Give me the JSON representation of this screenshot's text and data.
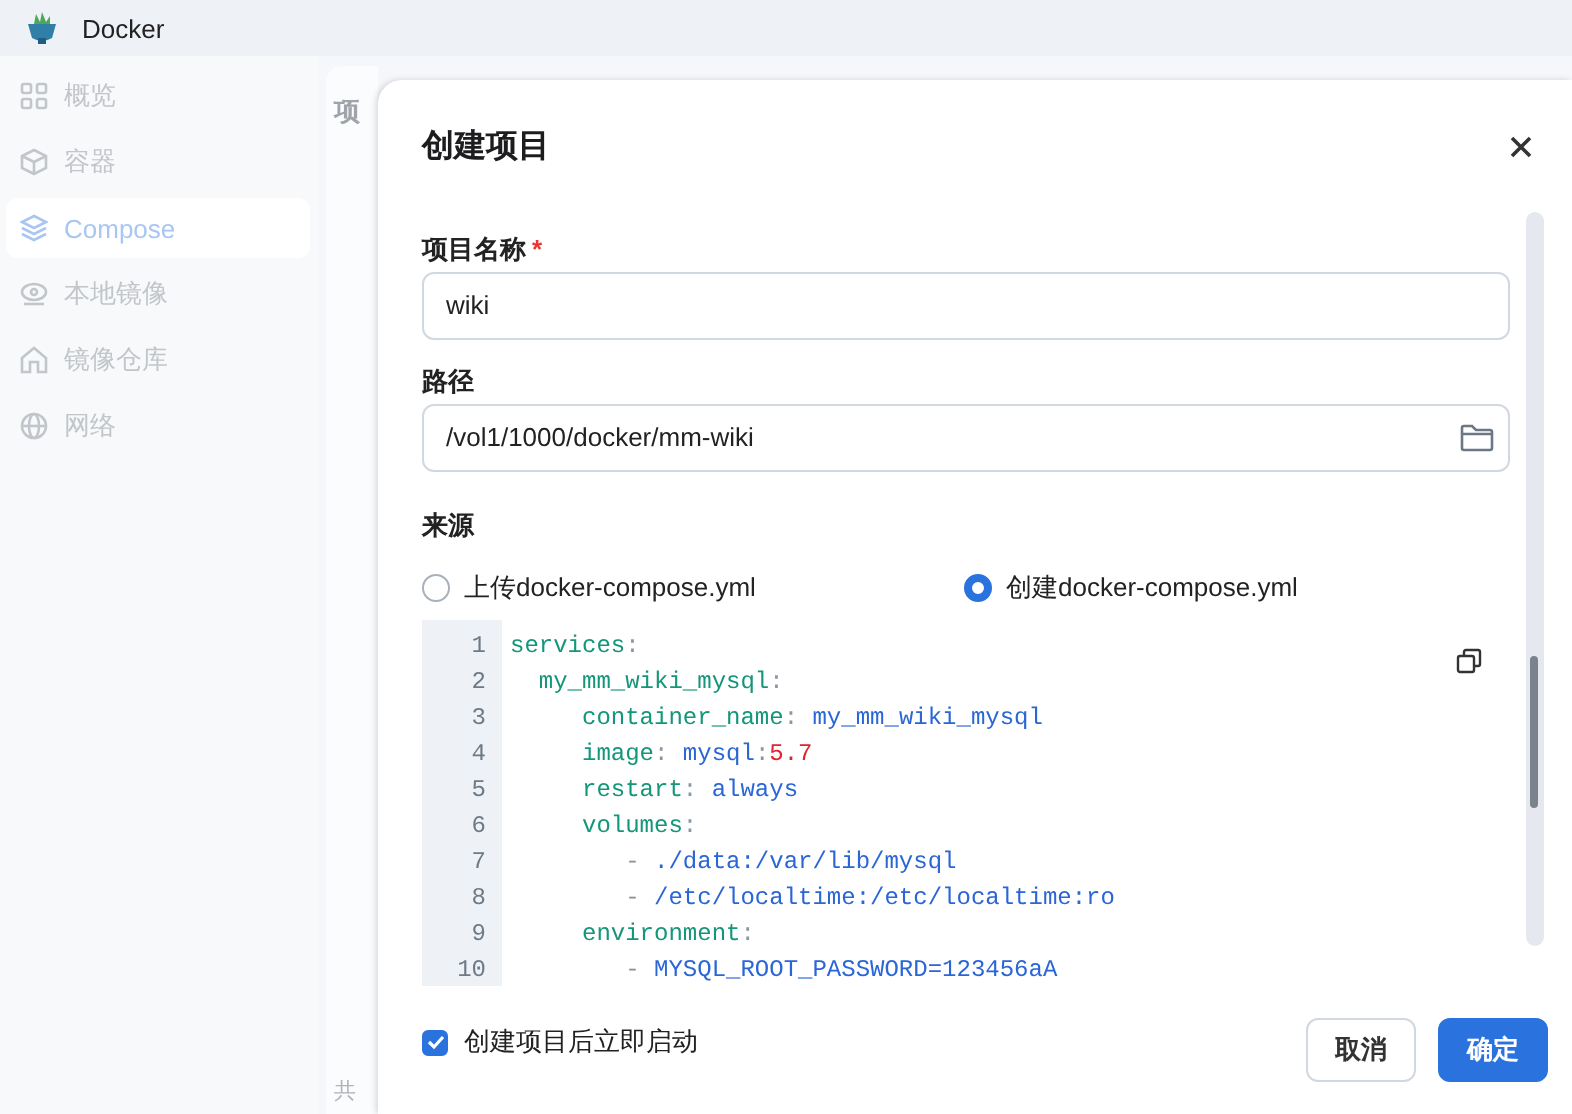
{
  "app": {
    "title": "Docker"
  },
  "sidebar": {
    "items": [
      {
        "label": "概览",
        "selected": false
      },
      {
        "label": "容器",
        "selected": false
      },
      {
        "label": "Compose",
        "selected": true
      },
      {
        "label": "本地镜像",
        "selected": false
      },
      {
        "label": "镜像仓库",
        "selected": false
      },
      {
        "label": "网络",
        "selected": false
      }
    ]
  },
  "background": {
    "heading": "项",
    "footer": "共"
  },
  "dialog": {
    "title": "创建项目",
    "name_field": {
      "label": "项目名称",
      "required_mark": "*",
      "value": "wiki"
    },
    "path_field": {
      "label": "路径",
      "value": "/vol1/1000/docker/mm-wiki"
    },
    "source": {
      "label": "来源",
      "options": [
        {
          "label": "上传docker-compose.yml",
          "selected": false
        },
        {
          "label": "创建docker-compose.yml",
          "selected": true
        }
      ]
    },
    "code_lines": [
      {
        "number": "1",
        "tokens": [
          {
            "kind": "key",
            "text": "services"
          },
          {
            "kind": "punct",
            "text": ":"
          }
        ]
      },
      {
        "number": "2",
        "tokens": [
          {
            "kind": "key",
            "text": "  my_mm_wiki_mysql"
          },
          {
            "kind": "punct",
            "text": ":"
          }
        ]
      },
      {
        "number": "3",
        "tokens": [
          {
            "kind": "key",
            "text": "     container_name"
          },
          {
            "kind": "punct",
            "text": ": "
          },
          {
            "kind": "value",
            "text": "my_mm_wiki_mysql"
          }
        ]
      },
      {
        "number": "4",
        "tokens": [
          {
            "kind": "key",
            "text": "     image"
          },
          {
            "kind": "punct",
            "text": ": "
          },
          {
            "kind": "value",
            "text": "mysql"
          },
          {
            "kind": "punct",
            "text": ":"
          },
          {
            "kind": "number",
            "text": "5.7"
          }
        ]
      },
      {
        "number": "5",
        "tokens": [
          {
            "kind": "key",
            "text": "     restart"
          },
          {
            "kind": "punct",
            "text": ": "
          },
          {
            "kind": "value",
            "text": "always"
          }
        ]
      },
      {
        "number": "6",
        "tokens": [
          {
            "kind": "key",
            "text": "     volumes"
          },
          {
            "kind": "punct",
            "text": ":"
          }
        ]
      },
      {
        "number": "7",
        "tokens": [
          {
            "kind": "punct",
            "text": "        - "
          },
          {
            "kind": "value",
            "text": "./data:/var/lib/mysql"
          }
        ]
      },
      {
        "number": "8",
        "tokens": [
          {
            "kind": "punct",
            "text": "        - "
          },
          {
            "kind": "value",
            "text": "/etc/localtime:/etc/localtime:ro"
          }
        ]
      },
      {
        "number": "9",
        "tokens": [
          {
            "kind": "key",
            "text": "     environment"
          },
          {
            "kind": "punct",
            "text": ":"
          }
        ]
      },
      {
        "number": "10",
        "tokens": [
          {
            "kind": "punct",
            "text": "        - "
          },
          {
            "kind": "value",
            "text": "MYSQL_ROOT_PASSWORD=123456aA"
          }
        ]
      }
    ],
    "autostart": {
      "label": "创建项目后立即启动",
      "checked": true
    },
    "buttons": [
      {
        "label": "取消",
        "kind": "secondary"
      },
      {
        "label": "确定",
        "kind": "primary"
      }
    ]
  }
}
